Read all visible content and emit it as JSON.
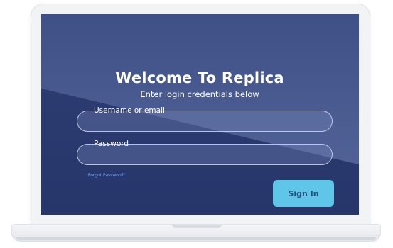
{
  "login": {
    "title": "Welcome To Replica",
    "subtitle": "Enter login credentials below",
    "username": {
      "label": "Username or email",
      "value": ""
    },
    "password": {
      "label": "Password",
      "value": ""
    },
    "forgot_link": "Forgot Password?",
    "signin_label": "Sign In"
  },
  "colors": {
    "screen_bg": "#28386b",
    "accent": "#5fc6e9",
    "link": "#7fa9ff"
  }
}
